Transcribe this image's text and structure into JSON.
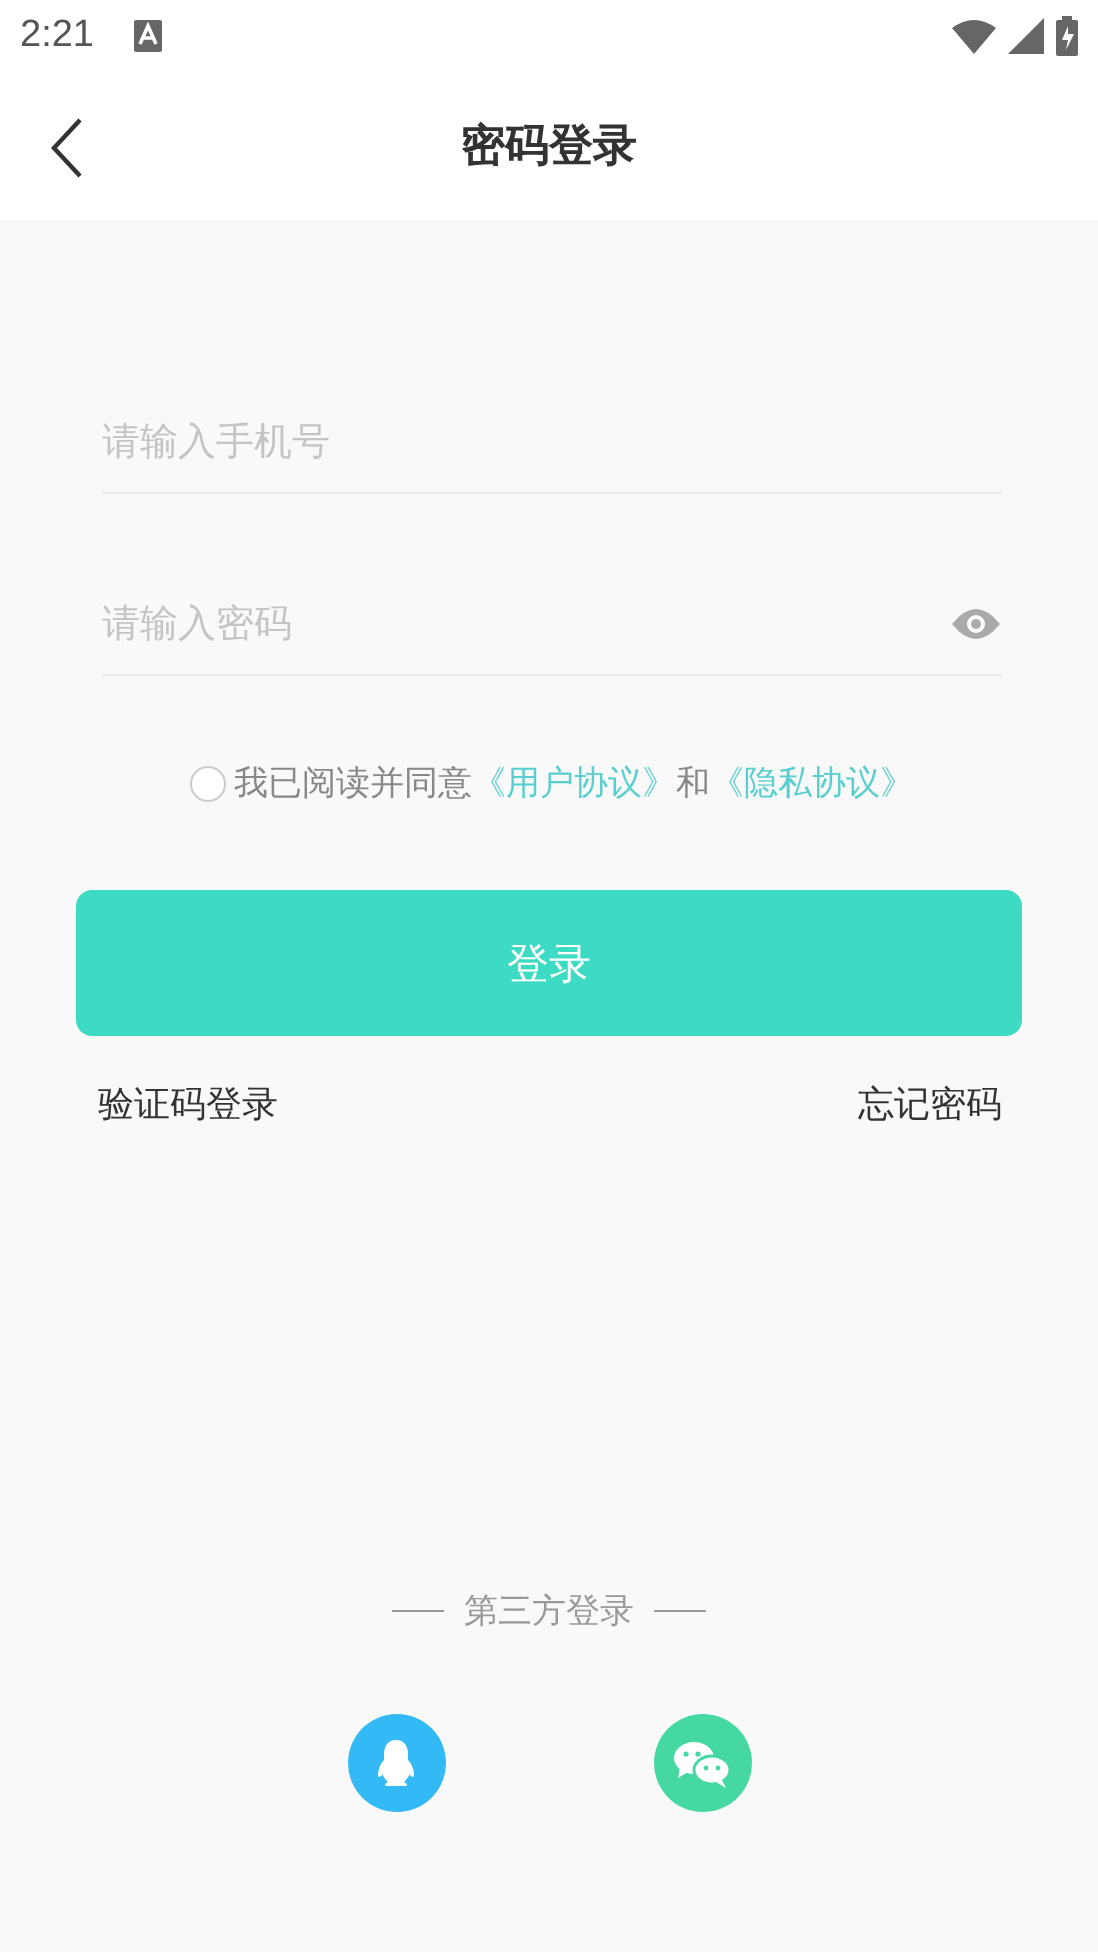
{
  "status_bar": {
    "time": "2:21"
  },
  "header": {
    "title": "密码登录"
  },
  "fields": [
    {
      "kind": "phone",
      "placeholder": "请输入手机号"
    },
    {
      "kind": "password",
      "placeholder": "请输入密码"
    }
  ],
  "agreement": {
    "checked": false,
    "text": "我已阅读并同意",
    "user_agreement": "《用户协议》",
    "conjunction": "和",
    "privacy_policy": "《隐私协议》"
  },
  "login_button": "登录",
  "links": [
    {
      "label": "验证码登录"
    },
    {
      "label": "忘记密码"
    }
  ],
  "third_party": {
    "label": "第三方登录",
    "providers": [
      {
        "kind": "qq",
        "color": "#33b9f5"
      },
      {
        "kind": "wechat",
        "color": "#46d8a2"
      }
    ]
  }
}
